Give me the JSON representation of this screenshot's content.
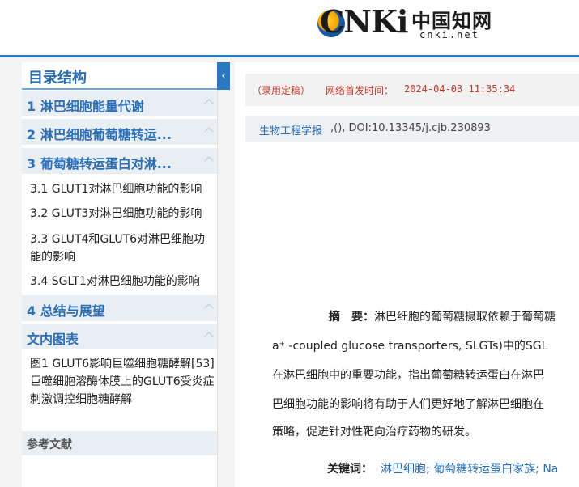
{
  "header": {
    "logo_cnki": "CNKi",
    "logo_cn": "中国知网",
    "logo_net": "cnki.net"
  },
  "sidebar": {
    "title": "目录结构",
    "collapse_glyph": "‹",
    "sections": [
      {
        "label": "1 淋巴细胞能量代谢"
      },
      {
        "label": "2 淋巴细胞葡萄糖转运..."
      },
      {
        "label": "3 葡萄糖转运蛋白对淋..."
      }
    ],
    "subsections": [
      {
        "label": "3.1 GLUT1对淋巴细胞功能的影响"
      },
      {
        "label": "3.2 GLUT3对淋巴细胞功能的影响"
      },
      {
        "label": "3.3 GLUT4和GLUT6对淋巴细胞功能的影响"
      },
      {
        "label": "3.4 SGLT1对淋巴细胞功能的影响"
      }
    ],
    "section4": "4 总结与展望",
    "figures_title": "文内图表",
    "figure1": "图1 GLUT6影响巨噬细胞糖酵解[53] 巨噬细胞溶酶体膜上的GLUT6受炎症刺激调控细胞糖酵解",
    "references": "参考文献"
  },
  "main": {
    "status": "（录用定稿）",
    "publish_label": "网络首发时间：",
    "publish_time": "2024-04-03 11:35:34",
    "journal": "生物工程学报",
    "doi": ",(), DOI:10.13345/j.cjb.230893",
    "abstract_label": "摘　要：",
    "abstract_lines": [
      "淋巴细胞的葡萄糖摄取依赖于葡萄糖",
      "a⁺ -coupled glucose transporters, SLGTs)中的SGL",
      "在淋巴细胞中的重要功能，指出葡萄糖转运蛋白在淋巴",
      "巴细胞功能的影响将有助于人们更好地了解淋巴细胞在",
      "策略，促进针对性靶向治疗药物的研发。"
    ],
    "keywords_label": "关键词：",
    "keywords": "淋巴细胞; 葡萄糖转运蛋白家族; Na"
  },
  "colors": {
    "accent": "#2b78c2",
    "link": "#2b6eb5",
    "status_red": "#c0392b"
  }
}
